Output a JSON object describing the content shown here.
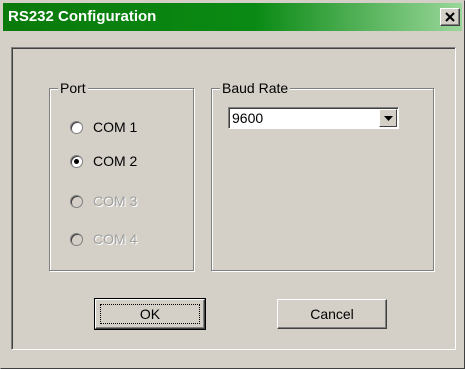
{
  "window": {
    "title": "RS232 Configuration",
    "close_icon": "close-icon",
    "title_gradient": [
      "#0a7a0a",
      "#9ad79a"
    ]
  },
  "port_group": {
    "label": "Port",
    "options": [
      {
        "label": "COM 1",
        "selected": false,
        "enabled": true
      },
      {
        "label": "COM 2",
        "selected": true,
        "enabled": true
      },
      {
        "label": "COM 3",
        "selected": false,
        "enabled": false
      },
      {
        "label": "COM 4",
        "selected": false,
        "enabled": false
      }
    ]
  },
  "baud_group": {
    "label": "Baud Rate",
    "selected_value": "9600",
    "dropdown_icon": "chevron-down-icon"
  },
  "buttons": {
    "ok_label": "OK",
    "cancel_label": "Cancel"
  }
}
